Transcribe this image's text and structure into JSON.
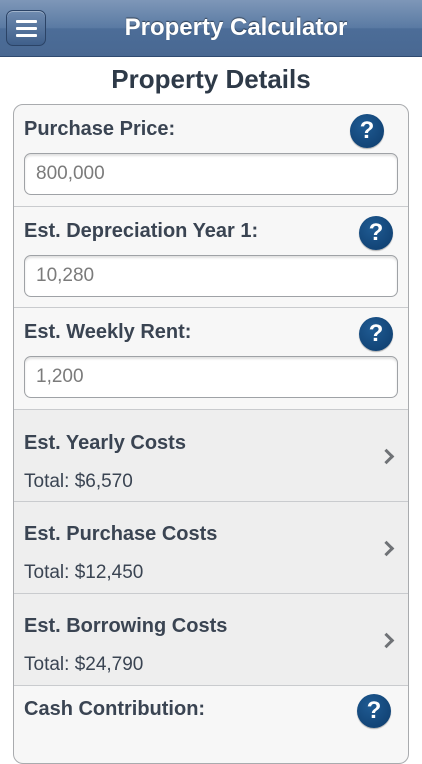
{
  "header": {
    "title": "Property Calculator",
    "menu_icon": "hamburger-menu-icon"
  },
  "page": {
    "heading": "Property Details"
  },
  "fields": [
    {
      "label": "Purchase Price:",
      "value": "800,000",
      "help_glyph": "?"
    },
    {
      "label": "Est. Depreciation Year 1:",
      "value": "10,280",
      "help_glyph": "?"
    },
    {
      "label": "Est. Weekly Rent:",
      "value": "1,200",
      "help_glyph": "?"
    }
  ],
  "cost_rows": [
    {
      "label": "Est. Yearly Costs",
      "total": "Total: $6,570"
    },
    {
      "label": "Est. Purchase Costs",
      "total": "Total: $12,450"
    },
    {
      "label": "Est. Borrowing Costs",
      "total": "Total: $24,790"
    }
  ],
  "cash_contribution": {
    "label": "Cash Contribution:",
    "help_glyph": "?"
  },
  "colors": {
    "navbar": "#5a7aa3",
    "help_button": "#0d3b6b",
    "label_text": "#3a4452"
  }
}
